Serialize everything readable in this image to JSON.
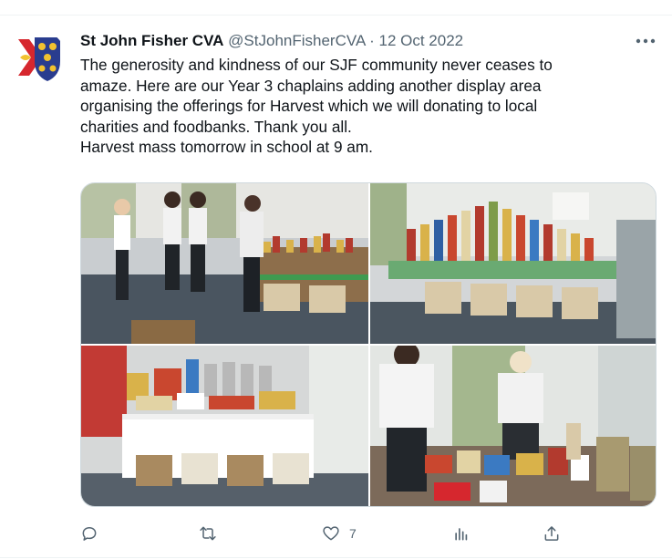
{
  "tweet": {
    "author_name": "St John Fisher CVA",
    "handle": "@StJohnFisherCVA",
    "separator": "·",
    "date": "12 Oct 2022",
    "text": "The generosity and kindness of our SJF community never ceases to\namaze. Here are our Year 3 chaplains adding another display area\norganising the offerings for Harvest which we will donating to local\ncharities and foodbanks. Thank you all.\nHarvest mass tomorrow in school at 9 am.",
    "more_icon": "more-dots-icon",
    "avatar_colors": [
      "#d6272e",
      "#2a3d8f",
      "#f2c230"
    ]
  },
  "media": {
    "photos": [
      {
        "description_icon": "photo-children-arranging-food"
      },
      {
        "description_icon": "photo-harvest-table-cans"
      },
      {
        "description_icon": "photo-small-harvest-display"
      },
      {
        "description_icon": "photo-children-sorting-food"
      }
    ]
  },
  "actions": {
    "reply_count": "",
    "retweet_count": "",
    "like_count": "7",
    "views_count": ""
  },
  "colors": {
    "text": "#0f1419",
    "secondary": "#536471",
    "border": "#cfd9de"
  }
}
